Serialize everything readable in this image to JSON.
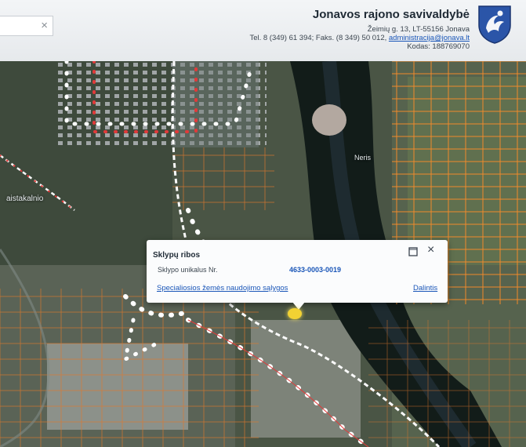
{
  "header": {
    "search_clear": "×",
    "org_name": "Jonavos rajono savivaldybė",
    "address": "Žeimių g. 13, LT-55156 Jonava",
    "contact_prefix": "Tel. 8 (349) 61 394; Faks. (8 349) 50 012,",
    "email": "administracija@jonava.lt",
    "code": "Kodas: 188769070",
    "coat_of_arms_icon": "coat-of-arms-icon"
  },
  "map": {
    "labels": {
      "river_left": "aistakalnio",
      "river_center": "Neris"
    },
    "colors": {
      "parcel_border": "#f08a2b",
      "road_dots": "#e23a3a",
      "river": "#111a18"
    }
  },
  "popup": {
    "title": "Sklypų ribos",
    "field_label": "Sklypo unikalus Nr.",
    "field_value": "4633-0003-0019",
    "link_label": "Specialiosios žemės naudojimo sąlygos",
    "share_label": "Dalintis",
    "close": "×"
  }
}
